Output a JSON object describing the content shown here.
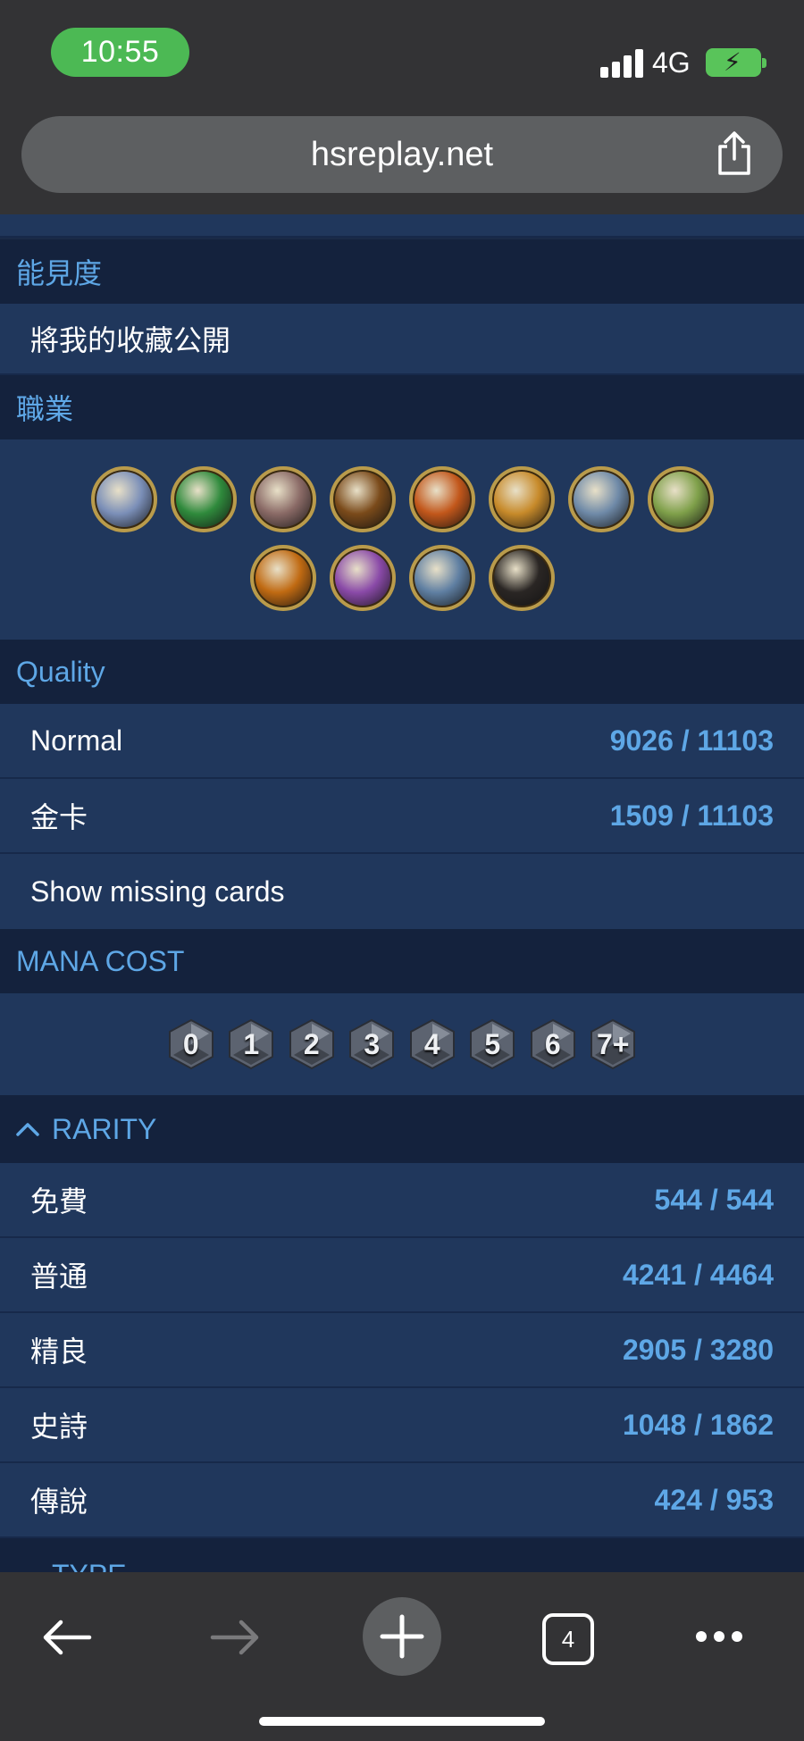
{
  "status_bar": {
    "time": "10:55",
    "network": "4G"
  },
  "browser": {
    "url": "hsreplay.net",
    "tab_count": "4"
  },
  "visibility": {
    "title": "能見度",
    "option": "將我的收藏公開"
  },
  "classes": {
    "title": "職業",
    "icons": [
      {
        "name": "death-knight-icon",
        "color": "#7b8fb8"
      },
      {
        "name": "demon-hunter-icon",
        "color": "#2f8a3c"
      },
      {
        "name": "druid-icon",
        "color": "#8a6a66"
      },
      {
        "name": "hunter-icon",
        "color": "#7a4a1a"
      },
      {
        "name": "mage-icon",
        "color": "#c2571b"
      },
      {
        "name": "paladin-icon",
        "color": "#c78a2a"
      },
      {
        "name": "priest-icon",
        "color": "#6f8aa8"
      },
      {
        "name": "rogue-icon",
        "color": "#7fa04a"
      },
      {
        "name": "shaman-icon",
        "color": "#c06a12"
      },
      {
        "name": "warlock-icon",
        "color": "#8a4aa8"
      },
      {
        "name": "warrior-icon",
        "color": "#5f7fa2"
      },
      {
        "name": "neutral-icon",
        "color": "#2a2624"
      }
    ]
  },
  "quality": {
    "title": "Quality",
    "rows": [
      {
        "label": "Normal",
        "value": "9026 / 11103"
      },
      {
        "label": "金卡",
        "value": "1509 / 11103"
      }
    ],
    "missing_label": "Show missing cards"
  },
  "mana_cost": {
    "title": "MANA COST",
    "gems": [
      "0",
      "1",
      "2",
      "3",
      "4",
      "5",
      "6",
      "7+"
    ]
  },
  "rarity": {
    "title": "RARITY",
    "rows": [
      {
        "label": "免費",
        "value": "544 / 544"
      },
      {
        "label": "普通",
        "value": "4241 / 4464"
      },
      {
        "label": "精良",
        "value": "2905 / 3280"
      },
      {
        "label": "史詩",
        "value": "1048 / 1862"
      },
      {
        "label": "傳說",
        "value": "424 / 953"
      }
    ]
  },
  "type": {
    "title": "TYPE"
  }
}
